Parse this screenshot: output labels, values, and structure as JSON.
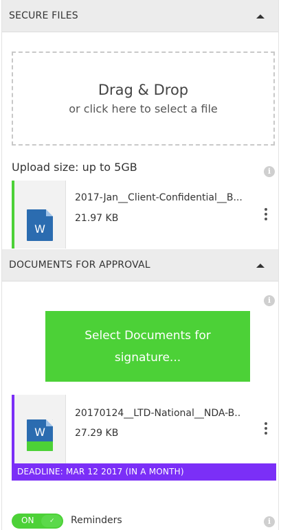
{
  "secure_files": {
    "header": "SECURE FILES",
    "dropzone": {
      "title": "Drag & Drop",
      "subtitle": "or click here to select a file"
    },
    "upload_size": "Upload size: up to 5GB",
    "file": {
      "name": "2017-Jan__Client-Confidential__B...",
      "size": "21.97 KB",
      "icon_letter": "W"
    }
  },
  "approval": {
    "header": "DOCUMENTS FOR APPROVAL",
    "select_button": "Select Documents for signature...",
    "file": {
      "name": "20170124__LTD-National__NDA-B..",
      "size": "27.29 KB",
      "icon_letter": "W",
      "deadline": "DEADLINE: MAR 12 2017 (IN A MONTH)"
    }
  },
  "footer": {
    "toggle_state": "ON",
    "reminders_label": "Reminders"
  },
  "colors": {
    "accent_green": "#4cd137",
    "accent_purple": "#7b2ff7",
    "doc_blue": "#2b6cb0",
    "header_bg": "#ececec"
  }
}
